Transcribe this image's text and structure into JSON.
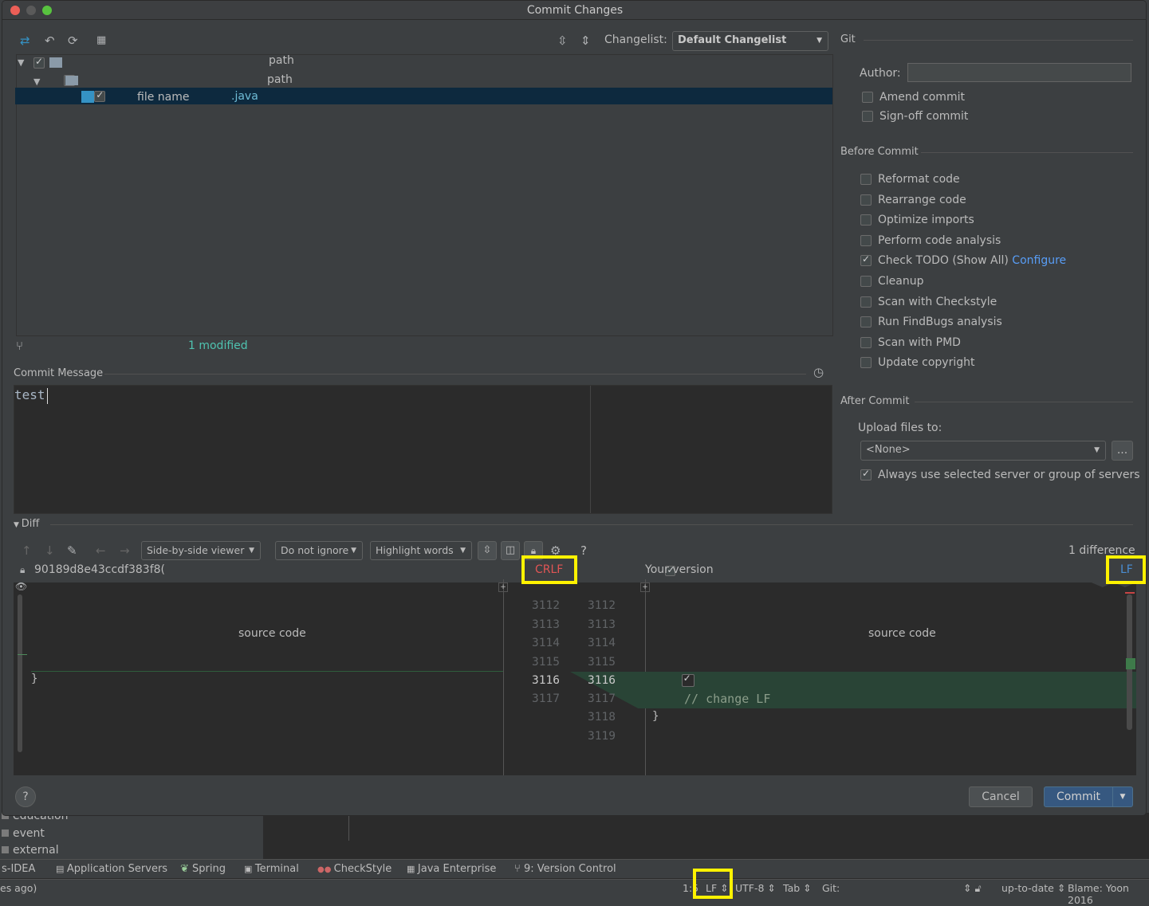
{
  "dialog": {
    "title": "Commit Changes"
  },
  "changes": {
    "changelist_label": "Changelist:",
    "changelist_value": "Default Changelist",
    "tree": [
      {
        "text": "path",
        "checked": true
      },
      {
        "text": "path",
        "checked": true
      },
      {
        "name": "file name",
        "ext": ".java",
        "checked": true
      }
    ],
    "status": "1 modified"
  },
  "commit_message": {
    "label": "Commit Message",
    "value": "test"
  },
  "git": {
    "section": "Git",
    "author_label": "Author:",
    "author_value": "",
    "amend": "Amend commit",
    "signoff": "Sign-off commit"
  },
  "before_commit": {
    "section": "Before Commit",
    "items": [
      {
        "label": "Reformat code",
        "checked": false
      },
      {
        "label": "Rearrange code",
        "checked": false
      },
      {
        "label": "Optimize imports",
        "checked": false
      },
      {
        "label": "Perform code analysis",
        "checked": false
      },
      {
        "label": "Check TODO (Show All)",
        "checked": true,
        "link": "Configure"
      },
      {
        "label": "Cleanup",
        "checked": false
      },
      {
        "label": "Scan with Checkstyle",
        "checked": false
      },
      {
        "label": "Run FindBugs analysis",
        "checked": false
      },
      {
        "label": "Scan with PMD",
        "checked": false
      },
      {
        "label": "Update copyright",
        "checked": false
      }
    ]
  },
  "after_commit": {
    "section": "After Commit",
    "upload_label": "Upload files to:",
    "upload_value": "<None>",
    "browse": "...",
    "always_use": "Always use selected server or group of servers",
    "always_checked": true
  },
  "diff": {
    "section": "Diff",
    "viewer": "Side-by-side viewer",
    "ignore": "Do not ignore",
    "highlight": "Highlight words",
    "help": "?",
    "difference_count": "1 difference",
    "left_title": "90189d8e43ccdf383f8(",
    "left_eol": "CRLF",
    "right_title": "Your version",
    "right_eol": "LF",
    "left_source": "source code",
    "right_source": "source code",
    "left_brace": "}",
    "right_brace": "}",
    "left_numbers": [
      "3112",
      "3113",
      "3114",
      "3115",
      "3116",
      "3117"
    ],
    "right_numbers": [
      "3112",
      "3113",
      "3114",
      "3115",
      "3116",
      "3117",
      "3118",
      "3119"
    ],
    "added_code": "// change LF"
  },
  "buttons": {
    "help": "?",
    "cancel": "Cancel",
    "commit": "Commit"
  },
  "workspace": {
    "project_items": [
      "education",
      "event",
      "external"
    ],
    "tool_windows": [
      "s-IDEA",
      "Application Servers",
      "Spring",
      "Terminal",
      "CheckStyle",
      "Java Enterprise",
      "9: Version Control"
    ],
    "status_left": "es ago)",
    "status": {
      "position": "1:5",
      "line_sep": "LF",
      "encoding": "UTF-8",
      "indent": "Tab",
      "vcs": "Git:",
      "uptodate": "up-to-date",
      "blame": "Blame: Yoon 2016"
    }
  },
  "colors": {
    "accent": "#3592c4",
    "added_bg": "#294436",
    "highlight_box": "#fff200",
    "crlf": "#e05555",
    "lf": "#4a8ed4",
    "link": "#589df6"
  }
}
